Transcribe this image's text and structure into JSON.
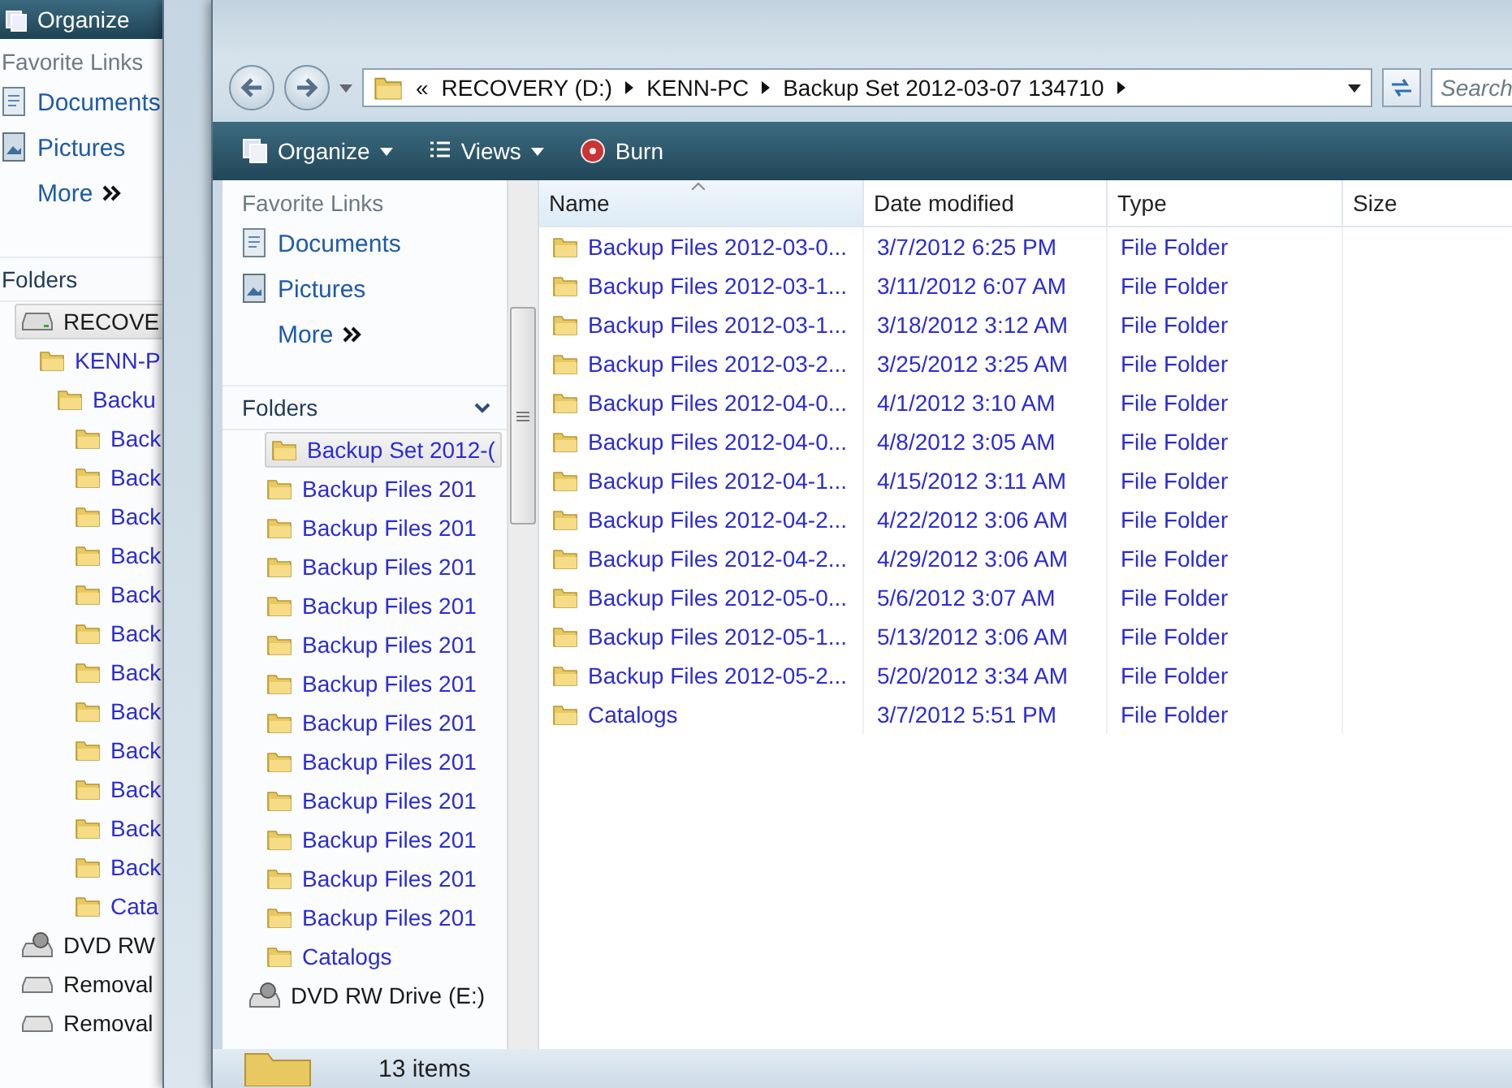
{
  "back_window": {
    "toolbar": {
      "label": "Organize"
    },
    "favorite_links": {
      "title": "Favorite Links",
      "items": [
        {
          "label": "Documents",
          "kind": "documents"
        },
        {
          "label": "Pictures",
          "kind": "pictures"
        },
        {
          "label": "More",
          "kind": "more"
        }
      ]
    },
    "folders": {
      "title": "Folders",
      "tree": [
        {
          "label": "RECOVE",
          "kind": "drive",
          "selected": true,
          "children": [
            {
              "label": "KENN-P",
              "kind": "folder",
              "selected": false,
              "children": [
                {
                  "label": "Backu",
                  "kind": "folder",
                  "selected": false,
                  "children": [
                    {
                      "label": "Back",
                      "kind": "folder",
                      "selected": false
                    },
                    {
                      "label": "Back",
                      "kind": "folder",
                      "selected": false
                    },
                    {
                      "label": "Back",
                      "kind": "folder",
                      "selected": false
                    },
                    {
                      "label": "Back",
                      "kind": "folder",
                      "selected": false
                    },
                    {
                      "label": "Back",
                      "kind": "folder",
                      "selected": false
                    },
                    {
                      "label": "Back",
                      "kind": "folder",
                      "selected": false
                    },
                    {
                      "label": "Back",
                      "kind": "folder",
                      "selected": false
                    },
                    {
                      "label": "Back",
                      "kind": "folder",
                      "selected": false
                    },
                    {
                      "label": "Back",
                      "kind": "folder",
                      "selected": false
                    },
                    {
                      "label": "Back",
                      "kind": "folder",
                      "selected": false
                    },
                    {
                      "label": "Back",
                      "kind": "folder",
                      "selected": false
                    },
                    {
                      "label": "Back",
                      "kind": "folder",
                      "selected": false
                    },
                    {
                      "label": "Cata",
                      "kind": "folder",
                      "selected": false
                    }
                  ]
                }
              ]
            }
          ]
        },
        {
          "label": "DVD RW",
          "kind": "dvd",
          "selected": false
        },
        {
          "label": "Removal",
          "kind": "removable",
          "selected": false
        },
        {
          "label": "Removal",
          "kind": "removable",
          "selected": false
        }
      ]
    }
  },
  "front_window": {
    "address": {
      "overflow": "«",
      "crumbs": [
        "RECOVERY (D:)",
        "KENN-PC",
        "Backup Set 2012-03-07 134710"
      ]
    },
    "search": {
      "placeholder": "Search"
    },
    "toolbar": [
      {
        "label": "Organize",
        "kind": "organize",
        "dropdown": true
      },
      {
        "label": "Views",
        "kind": "views",
        "dropdown": true
      },
      {
        "label": "Burn",
        "kind": "burn",
        "dropdown": false
      }
    ],
    "favorite_links": {
      "title": "Favorite Links",
      "items": [
        {
          "label": "Documents",
          "kind": "documents"
        },
        {
          "label": "Pictures",
          "kind": "pictures"
        },
        {
          "label": "More",
          "kind": "more"
        }
      ]
    },
    "folders": {
      "title": "Folders",
      "expanded": true,
      "tree": [
        {
          "label": "Backup Set 2012-(",
          "kind": "folder",
          "selected": true,
          "children": [
            {
              "label": "Backup Files 201",
              "kind": "folder",
              "selected": false
            },
            {
              "label": "Backup Files 201",
              "kind": "folder",
              "selected": false
            },
            {
              "label": "Backup Files 201",
              "kind": "folder",
              "selected": false
            },
            {
              "label": "Backup Files 201",
              "kind": "folder",
              "selected": false
            },
            {
              "label": "Backup Files 201",
              "kind": "folder",
              "selected": false
            },
            {
              "label": "Backup Files 201",
              "kind": "folder",
              "selected": false
            },
            {
              "label": "Backup Files 201",
              "kind": "folder",
              "selected": false
            },
            {
              "label": "Backup Files 201",
              "kind": "folder",
              "selected": false
            },
            {
              "label": "Backup Files 201",
              "kind": "folder",
              "selected": false
            },
            {
              "label": "Backup Files 201",
              "kind": "folder",
              "selected": false
            },
            {
              "label": "Backup Files 201",
              "kind": "folder",
              "selected": false
            },
            {
              "label": "Backup Files 201",
              "kind": "folder",
              "selected": false
            },
            {
              "label": "Catalogs",
              "kind": "folder",
              "selected": false
            }
          ]
        },
        {
          "label": "DVD RW Drive (E:)",
          "kind": "dvd",
          "selected": false
        }
      ]
    },
    "table": {
      "columns": [
        {
          "label": "Name",
          "sorted": true
        },
        {
          "label": "Date modified",
          "sorted": false
        },
        {
          "label": "Type",
          "sorted": false
        },
        {
          "label": "Size",
          "sorted": false
        }
      ],
      "rows": [
        {
          "name": "Backup Files 2012-03-0...",
          "date": "3/7/2012 6:25 PM",
          "type": "File Folder"
        },
        {
          "name": "Backup Files 2012-03-1...",
          "date": "3/11/2012 6:07 AM",
          "type": "File Folder"
        },
        {
          "name": "Backup Files 2012-03-1...",
          "date": "3/18/2012 3:12 AM",
          "type": "File Folder"
        },
        {
          "name": "Backup Files 2012-03-2...",
          "date": "3/25/2012 3:25 AM",
          "type": "File Folder"
        },
        {
          "name": "Backup Files 2012-04-0...",
          "date": "4/1/2012 3:10 AM",
          "type": "File Folder"
        },
        {
          "name": "Backup Files 2012-04-0...",
          "date": "4/8/2012 3:05 AM",
          "type": "File Folder"
        },
        {
          "name": "Backup Files 2012-04-1...",
          "date": "4/15/2012 3:11 AM",
          "type": "File Folder"
        },
        {
          "name": "Backup Files 2012-04-2...",
          "date": "4/22/2012 3:06 AM",
          "type": "File Folder"
        },
        {
          "name": "Backup Files 2012-04-2...",
          "date": "4/29/2012 3:06 AM",
          "type": "File Folder"
        },
        {
          "name": "Backup Files 2012-05-0...",
          "date": "5/6/2012 3:07 AM",
          "type": "File Folder"
        },
        {
          "name": "Backup Files 2012-05-1...",
          "date": "5/13/2012 3:06 AM",
          "type": "File Folder"
        },
        {
          "name": "Backup Files 2012-05-2...",
          "date": "5/20/2012 3:34 AM",
          "type": "File Folder"
        },
        {
          "name": "Catalogs",
          "date": "3/7/2012 5:51 PM",
          "type": "File Folder"
        }
      ]
    },
    "status_bar": {
      "text": "13 items"
    }
  }
}
